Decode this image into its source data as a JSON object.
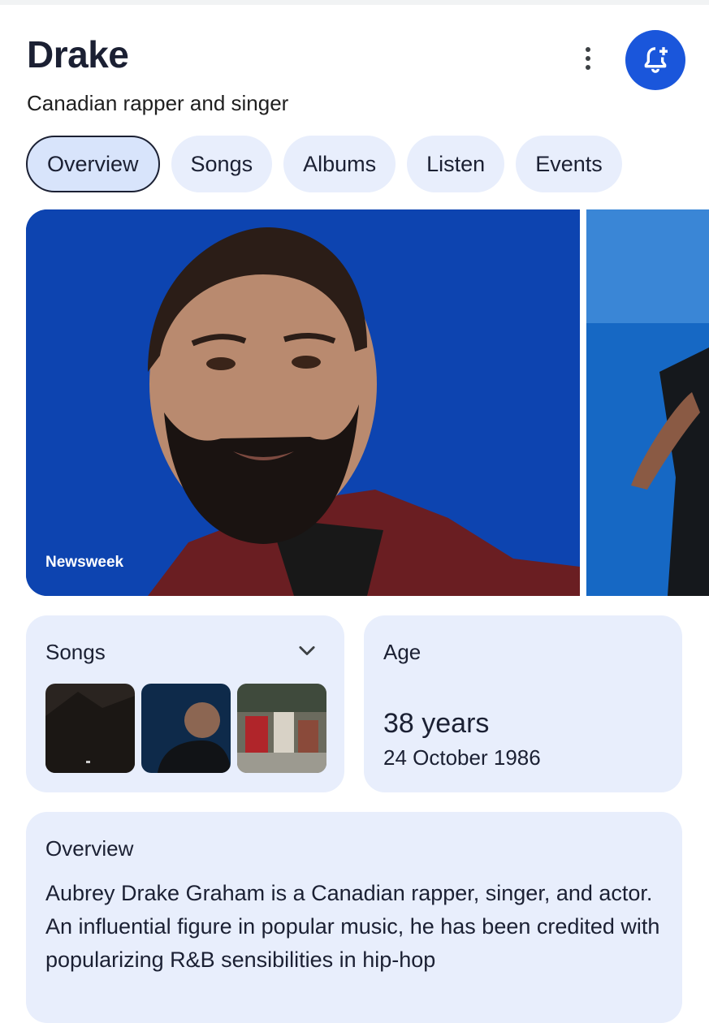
{
  "entity": {
    "name": "Drake",
    "description": "Canadian rapper and singer"
  },
  "header_actions": {
    "more_icon": "more-vertical-icon",
    "notify_icon": "bell-plus-icon"
  },
  "tabs": [
    {
      "label": "Overview",
      "active": true
    },
    {
      "label": "Songs",
      "active": false
    },
    {
      "label": "Albums",
      "active": false
    },
    {
      "label": "Listen",
      "active": false
    },
    {
      "label": "Events",
      "active": false
    }
  ],
  "images": {
    "main_credit": "Newsweek"
  },
  "songs_card": {
    "label": "Songs",
    "expand_icon": "chevron-down-icon"
  },
  "age_card": {
    "label": "Age",
    "value": "38 years",
    "birth_date": "24 October 1986"
  },
  "overview_card": {
    "label": "Overview",
    "text": "Aubrey Drake Graham is a Canadian rapper, singer, and actor. An influential figure in popular music, he has been credited with popularizing R&B sensibilities in hip-hop"
  },
  "colors": {
    "accent": "#1a56db",
    "chip_bg": "#e8eefc",
    "card_bg": "#e8eefc",
    "text": "#1b2033"
  }
}
